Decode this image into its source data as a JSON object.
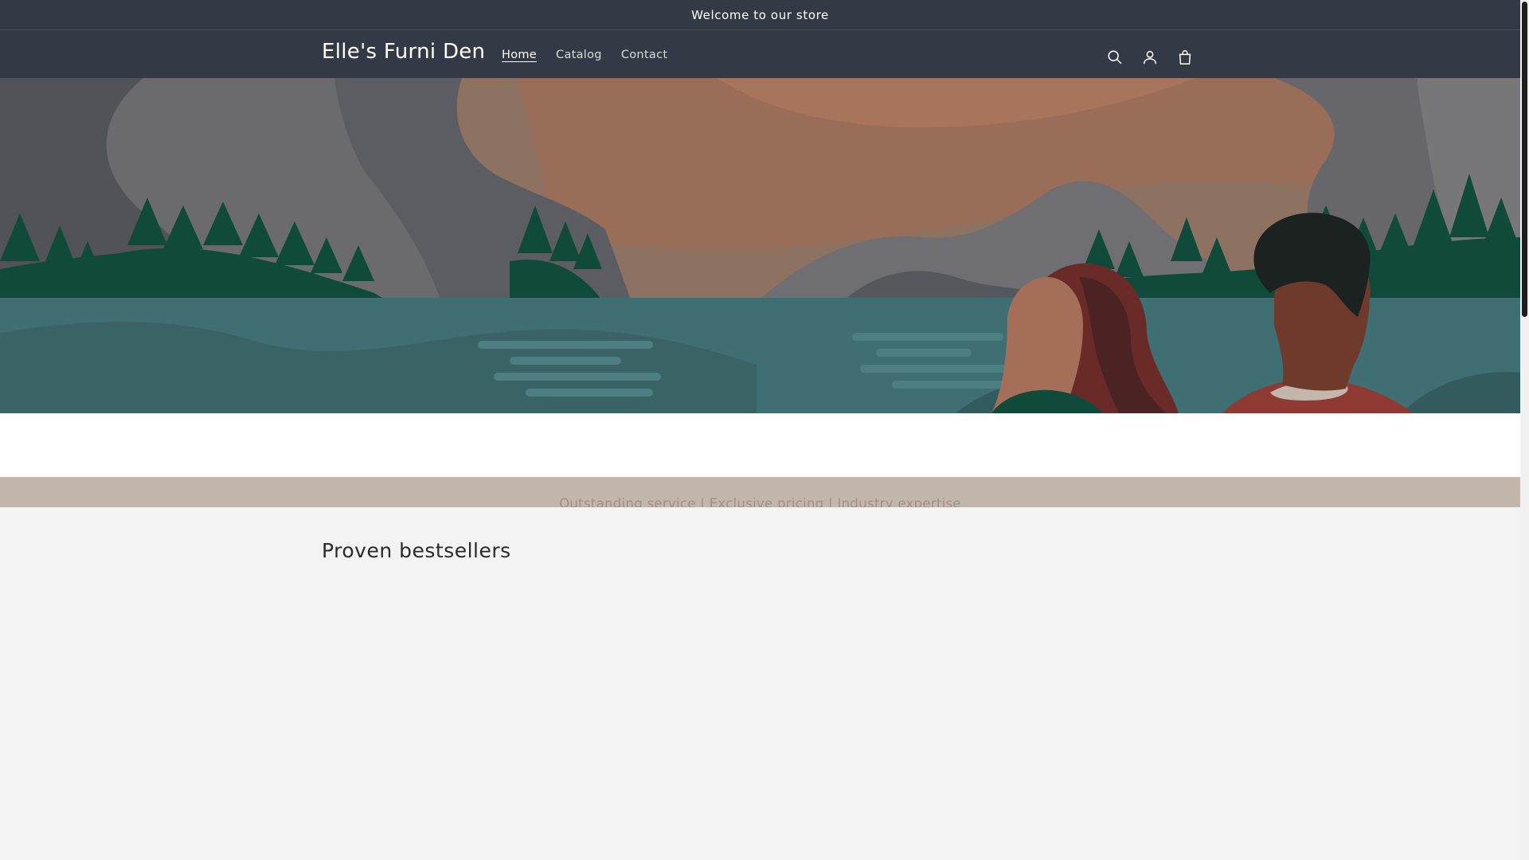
{
  "announcement": {
    "text": "Welcome to our store"
  },
  "header": {
    "logo": "Elle's Furni Den",
    "nav": [
      {
        "label": "Home",
        "active": true
      },
      {
        "label": "Catalog",
        "active": false
      },
      {
        "label": "Contact",
        "active": false
      }
    ],
    "icons": [
      "search-icon",
      "account-icon",
      "cart-icon"
    ]
  },
  "hero": {
    "image": "illustration of two people looking at mountains, forest and a lake"
  },
  "value_strip": {
    "text": "Outstanding service | Exclusive pricing | Industry expertise"
  },
  "bestsellers": {
    "title": "Proven bestsellers"
  },
  "colors": {
    "header_bg": "#343a45",
    "value_strip_bg": "#c3b6aa",
    "section_bg": "#f3f3f3"
  }
}
